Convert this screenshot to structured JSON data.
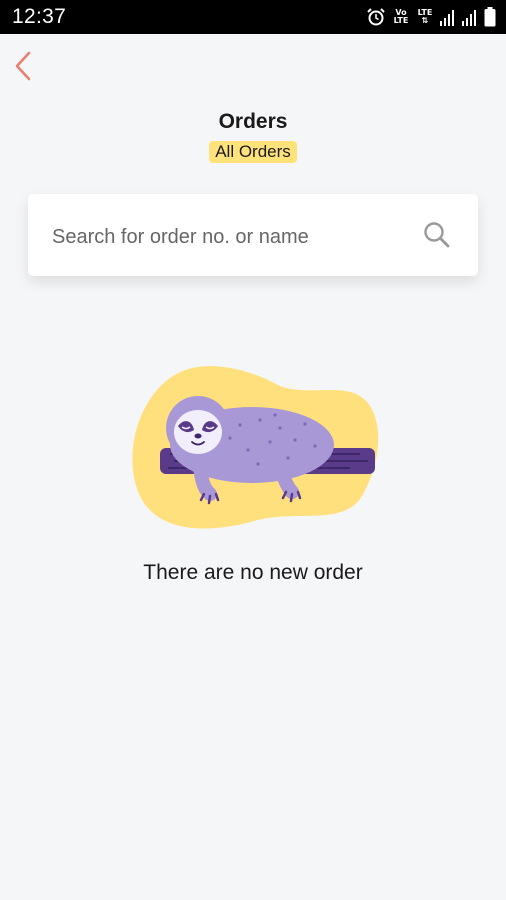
{
  "status_bar": {
    "time": "12:37",
    "icons": [
      "alarm-icon",
      "volte-icon",
      "lte-icon",
      "signal-icon",
      "signal-icon",
      "battery-icon"
    ],
    "volte_label_top": "Vo",
    "volte_label_bottom": "LTE",
    "lte_label": "LTE"
  },
  "header": {
    "back_icon": "chevron-left-icon",
    "title": "Orders",
    "filter_label": "All Orders"
  },
  "search": {
    "placeholder": "Search for order no. or name",
    "value": "",
    "icon": "search-icon"
  },
  "empty_state": {
    "illustration": "sleeping-sloth-illustration",
    "message": "There are no new order"
  },
  "colors": {
    "accent_yellow": "#ffe27a",
    "back_chevron": "#e8806f",
    "sloth_purple": "#9f8fcf",
    "background": "#f5f6f8"
  }
}
